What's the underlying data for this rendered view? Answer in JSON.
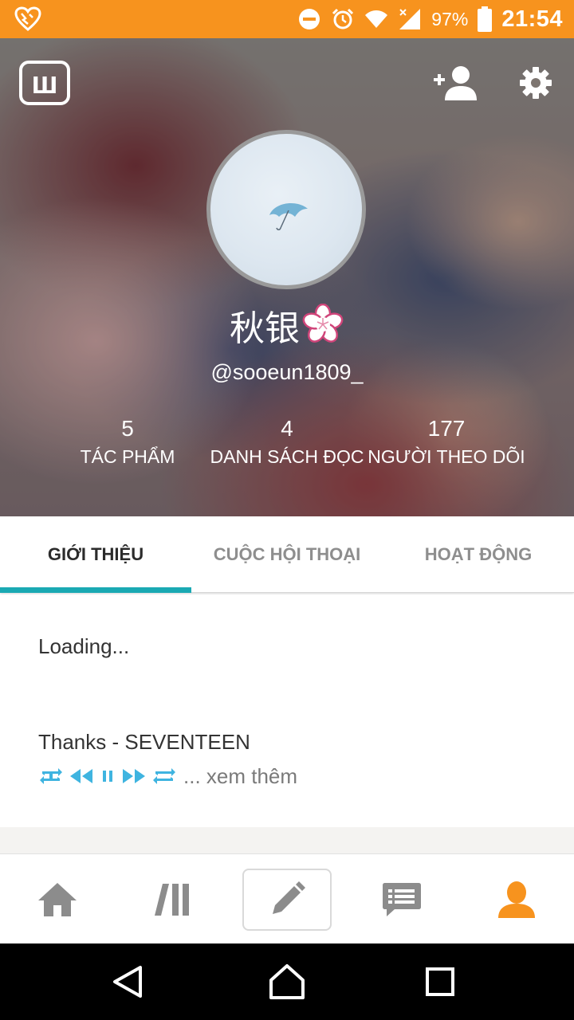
{
  "status_bar": {
    "battery_percent": "97%",
    "time": "21:54",
    "icons": [
      "app-notification-icon",
      "do-not-disturb-icon",
      "alarm-icon",
      "wifi-icon",
      "signal-icon",
      "battery-icon"
    ]
  },
  "header": {
    "logo_text": "ш",
    "add_user_icon": "add-user-icon",
    "settings_icon": "gear-icon"
  },
  "profile": {
    "display_name": "秋银",
    "username": "@sooeun1809_",
    "stats": [
      {
        "value": "5",
        "label": "TÁC PHẨM"
      },
      {
        "value": "4",
        "label": "DANH SÁCH ĐỌC"
      },
      {
        "value": "177",
        "label": "NGƯỜI THEO DÕI"
      }
    ]
  },
  "tabs": [
    {
      "label": "GIỚI THIỆU",
      "active": true
    },
    {
      "label": "CUỘC HỘI THOẠI",
      "active": false
    },
    {
      "label": "HOẠT ĐỘNG",
      "active": false
    }
  ],
  "about": {
    "loading_text": "Loading...",
    "song_text": "Thanks - SEVENTEEN",
    "see_more": "... xem thêm"
  },
  "bottom_nav": [
    {
      "name": "home-icon",
      "active": false
    },
    {
      "name": "library-icon",
      "active": false
    },
    {
      "name": "write-icon",
      "active": false
    },
    {
      "name": "messages-icon",
      "active": false
    },
    {
      "name": "profile-icon",
      "active": true
    }
  ],
  "colors": {
    "status_bar": "#f7931e",
    "accent_teal": "#1aa9b3",
    "nav_active": "#f7931e",
    "nav_inactive": "#8c8c8c",
    "controls_blue": "#3fb4e0"
  }
}
